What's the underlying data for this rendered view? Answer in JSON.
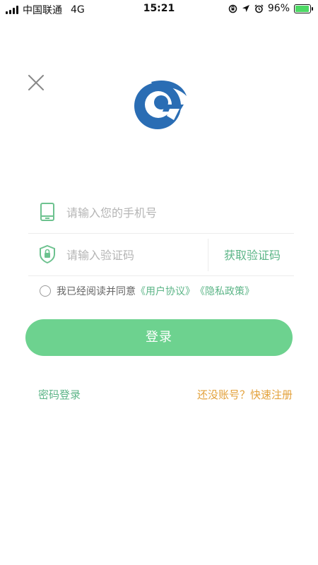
{
  "status_bar": {
    "carrier": "中国联通",
    "network": "4G",
    "time": "15:21",
    "battery": "96%",
    "battery_level": 0.96,
    "icons": [
      "signal-icon",
      "orientation-lock-icon",
      "location-icon",
      "alarm-icon",
      "battery-icon"
    ]
  },
  "colors": {
    "accent_green": "#5cb587",
    "button_green": "#6dd28f",
    "register_orange": "#e3a13a",
    "logo_blue": "#2a6db4"
  },
  "form": {
    "phone_placeholder": "请输入您的手机号",
    "code_placeholder": "请输入验证码",
    "get_code_label": "获取验证码"
  },
  "agreement": {
    "prefix": "我已经阅读并同意",
    "user_agreement": "《用户协议》",
    "privacy_policy": "《隐私政策》"
  },
  "login_label": "登录",
  "password_login_label": "密码登录",
  "register_label": "还没账号？快速注册"
}
